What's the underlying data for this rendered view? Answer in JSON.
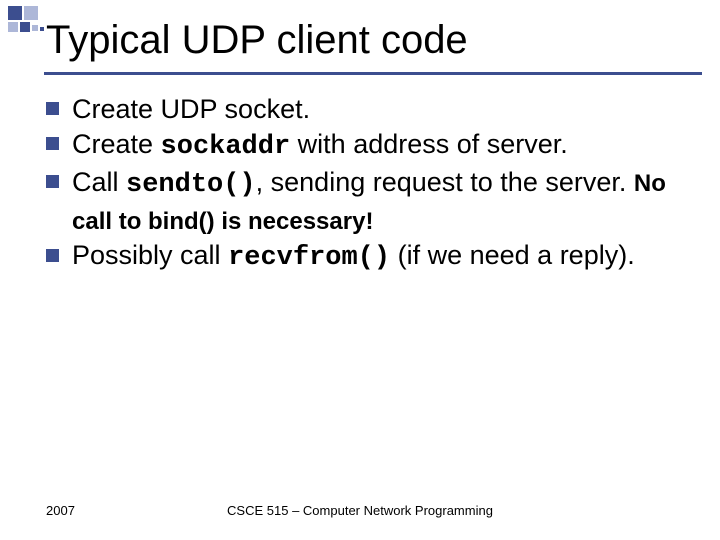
{
  "title": "Typical UDP client code",
  "bullets": [
    {
      "pre": "Create UDP socket."
    },
    {
      "pre": "Create ",
      "code": "sockaddr",
      "post": " with address of  server."
    },
    {
      "pre": "Call ",
      "code": "sendto()",
      "post": ", sending request to the server. ",
      "emph": "No call to bind() is necessary!"
    },
    {
      "pre": "Possibly call ",
      "code": "recvfrom()",
      "post": " (if we need a reply)."
    }
  ],
  "footer": {
    "year": "2007",
    "course": "CSCE 515 – Computer Network Programming"
  }
}
